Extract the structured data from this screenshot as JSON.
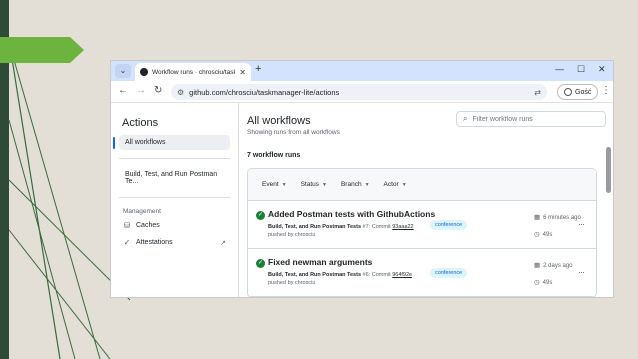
{
  "colors": {
    "slide_bg": "#e3dfd6",
    "accent_green": "#6db33f",
    "dark_green": "#2f4a36",
    "success": "#1a7f37",
    "link_blue": "#0969da"
  },
  "browser": {
    "tab_title": "Workflow runs · chrosciu/taskma",
    "tab_close": "✕",
    "tab_menu": "⌄",
    "new_tab": "+",
    "controls": {
      "minimize": "—",
      "maximize": "☐",
      "close": "✕"
    },
    "nav": {
      "back": "←",
      "forward": "→",
      "reload": "↻"
    },
    "url": "github.com/chrosciu/taskmanager-lite/actions",
    "profile_label": "Gość",
    "menu": "⋮"
  },
  "sidebar": {
    "title": "Actions",
    "all_workflows": "All workflows",
    "workflow_item": "Build, Test, and Run Postman Te...",
    "management_heading": "Management",
    "caches": "Caches",
    "attestations": "Attestations"
  },
  "main": {
    "title": "All workflows",
    "subtitle": "Showing runs from all workflows",
    "filter_placeholder": "Filter workflow runs",
    "count": "7 workflow runs",
    "filters": [
      "Event",
      "Status",
      "Branch",
      "Actor"
    ]
  },
  "runs": [
    {
      "title": "Added Postman tests with GithubActions",
      "workflow": "Build, Test, and Run Postman Tests",
      "run_info": " #7: Commit ",
      "commit": "93aaa22",
      "pushed_by": "pushed by chrosciu",
      "branch": "conference",
      "when": "6 minutes ago",
      "duration": "49s"
    },
    {
      "title": "Fixed newman arguments",
      "workflow": "Build, Test, and Run Postman Tests",
      "run_info": " #6: Commit ",
      "commit": "964f92e",
      "pushed_by": "pushed by chrosciu",
      "branch": "conference",
      "when": "2 days ago",
      "duration": "49s"
    }
  ]
}
